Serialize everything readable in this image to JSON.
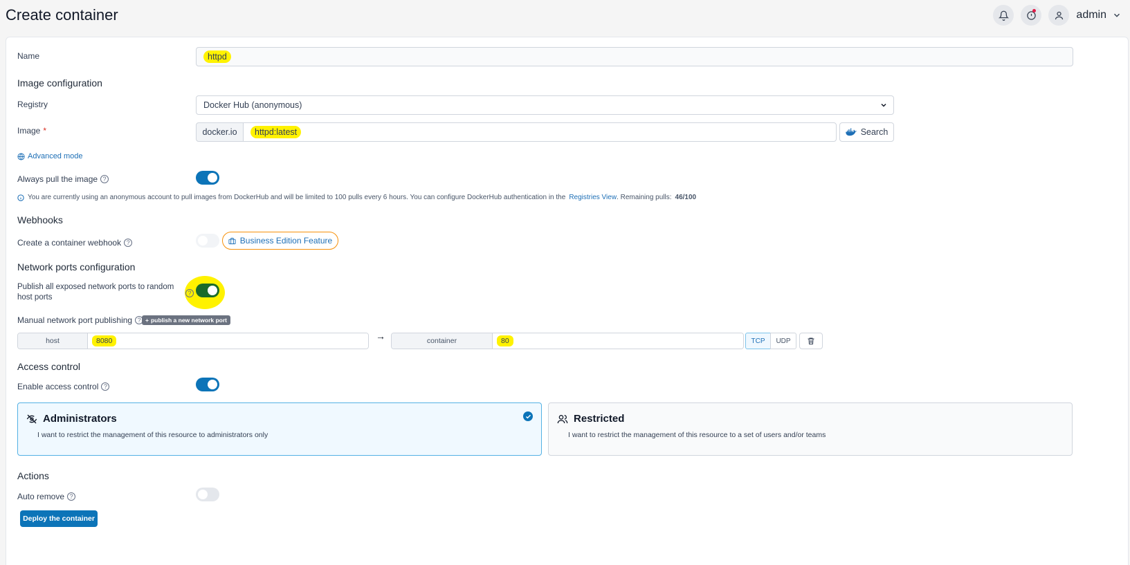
{
  "header": {
    "title": "Create container",
    "user": "admin"
  },
  "form": {
    "name_label": "Name",
    "name_value": "httpd",
    "image_config_title": "Image configuration",
    "registry_label": "Registry",
    "registry_value": "Docker Hub (anonymous)",
    "image_label": "Image",
    "image_required": "*",
    "image_prefix": "docker.io",
    "image_value": "httpd:latest",
    "search_label": "Search",
    "advanced_mode": "Advanced mode",
    "always_pull_label": "Always pull the image",
    "always_pull": true,
    "info_text": "You are currently using an anonymous account to pull images from DockerHub and will be limited to 100 pulls every 6 hours. You can configure DockerHub authentication in the",
    "info_link": "Registries View",
    "info_remaining_label": ". Remaining pulls:",
    "info_remaining_value": "46/100",
    "webhooks_title": "Webhooks",
    "webhook_label": "Create a container webhook",
    "webhook_enabled": false,
    "business_badge": "Business Edition Feature",
    "network_title": "Network ports configuration",
    "publish_all_label": "Publish all exposed network ports to random host ports",
    "publish_all": true,
    "manual_port_label": "Manual network port publishing",
    "publish_new_port": "publish a new network port",
    "port_host_label": "host",
    "port_host_value": "8080",
    "port_container_label": "container",
    "port_container_value": "80",
    "proto_tcp": "TCP",
    "proto_udp": "UDP",
    "access_title": "Access control",
    "access_label": "Enable access control",
    "access_enabled": true,
    "admin_title": "Administrators",
    "admin_desc": "I want to restrict the management of this resource to administrators only",
    "restricted_title": "Restricted",
    "restricted_desc": "I want to restrict the management of this resource to a set of users and/or teams",
    "actions_title": "Actions",
    "auto_remove_label": "Auto remove",
    "auto_remove": false,
    "deploy_label": "Deploy the container"
  },
  "colors": {
    "primary": "#0c74b8",
    "highlight": "#fff200",
    "badge_border": "#f79009"
  }
}
